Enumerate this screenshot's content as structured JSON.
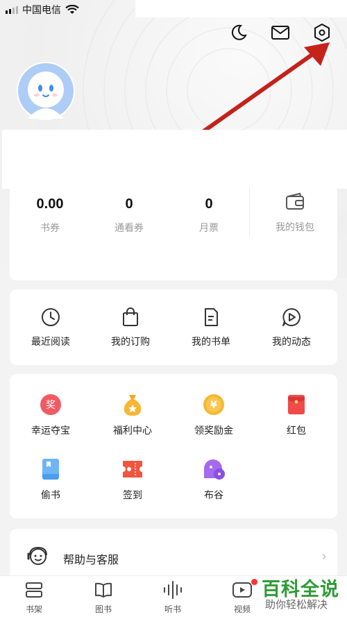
{
  "status_bar": {
    "carrier": "中国电信"
  },
  "stats": [
    {
      "value": "0.00",
      "label": "书券"
    },
    {
      "value": "0",
      "label": "通看券"
    },
    {
      "value": "0",
      "label": "月票"
    }
  ],
  "wallet": {
    "label": "我的钱包"
  },
  "quick_actions": [
    {
      "label": "最近阅读",
      "icon": "clock-icon"
    },
    {
      "label": "我的订购",
      "icon": "shopping-bag-icon"
    },
    {
      "label": "我的书单",
      "icon": "booklist-icon"
    },
    {
      "label": "我的动态",
      "icon": "play-bubble-icon"
    }
  ],
  "features": [
    {
      "label": "幸运夺宝",
      "icon": "lucky-treasure-icon",
      "glyph": "奖"
    },
    {
      "label": "福利中心",
      "icon": "money-bag-icon"
    },
    {
      "label": "领奖励金",
      "icon": "coin-icon",
      "glyph": "¥"
    },
    {
      "label": "红包",
      "icon": "red-envelope-icon"
    },
    {
      "label": "偷书",
      "icon": "book-icon"
    },
    {
      "label": "签到",
      "icon": "ticket-icon"
    },
    {
      "label": "布谷",
      "icon": "bird-chat-icon"
    }
  ],
  "help": {
    "label": "帮助与客服",
    "chevron": "›"
  },
  "bottom_nav": [
    {
      "label": "书架",
      "icon": "bookshelf-icon"
    },
    {
      "label": "图书",
      "icon": "open-book-icon"
    },
    {
      "label": "听书",
      "icon": "soundwave-icon"
    },
    {
      "label": "视频",
      "icon": "video-icon"
    }
  ],
  "watermark": {
    "title": "百科全说",
    "subtitle": "助你轻松解决"
  },
  "colors": {
    "accent_red": "#e03b3b",
    "arrow_red": "#c4221b",
    "watermark_green": "#2e9c36"
  }
}
